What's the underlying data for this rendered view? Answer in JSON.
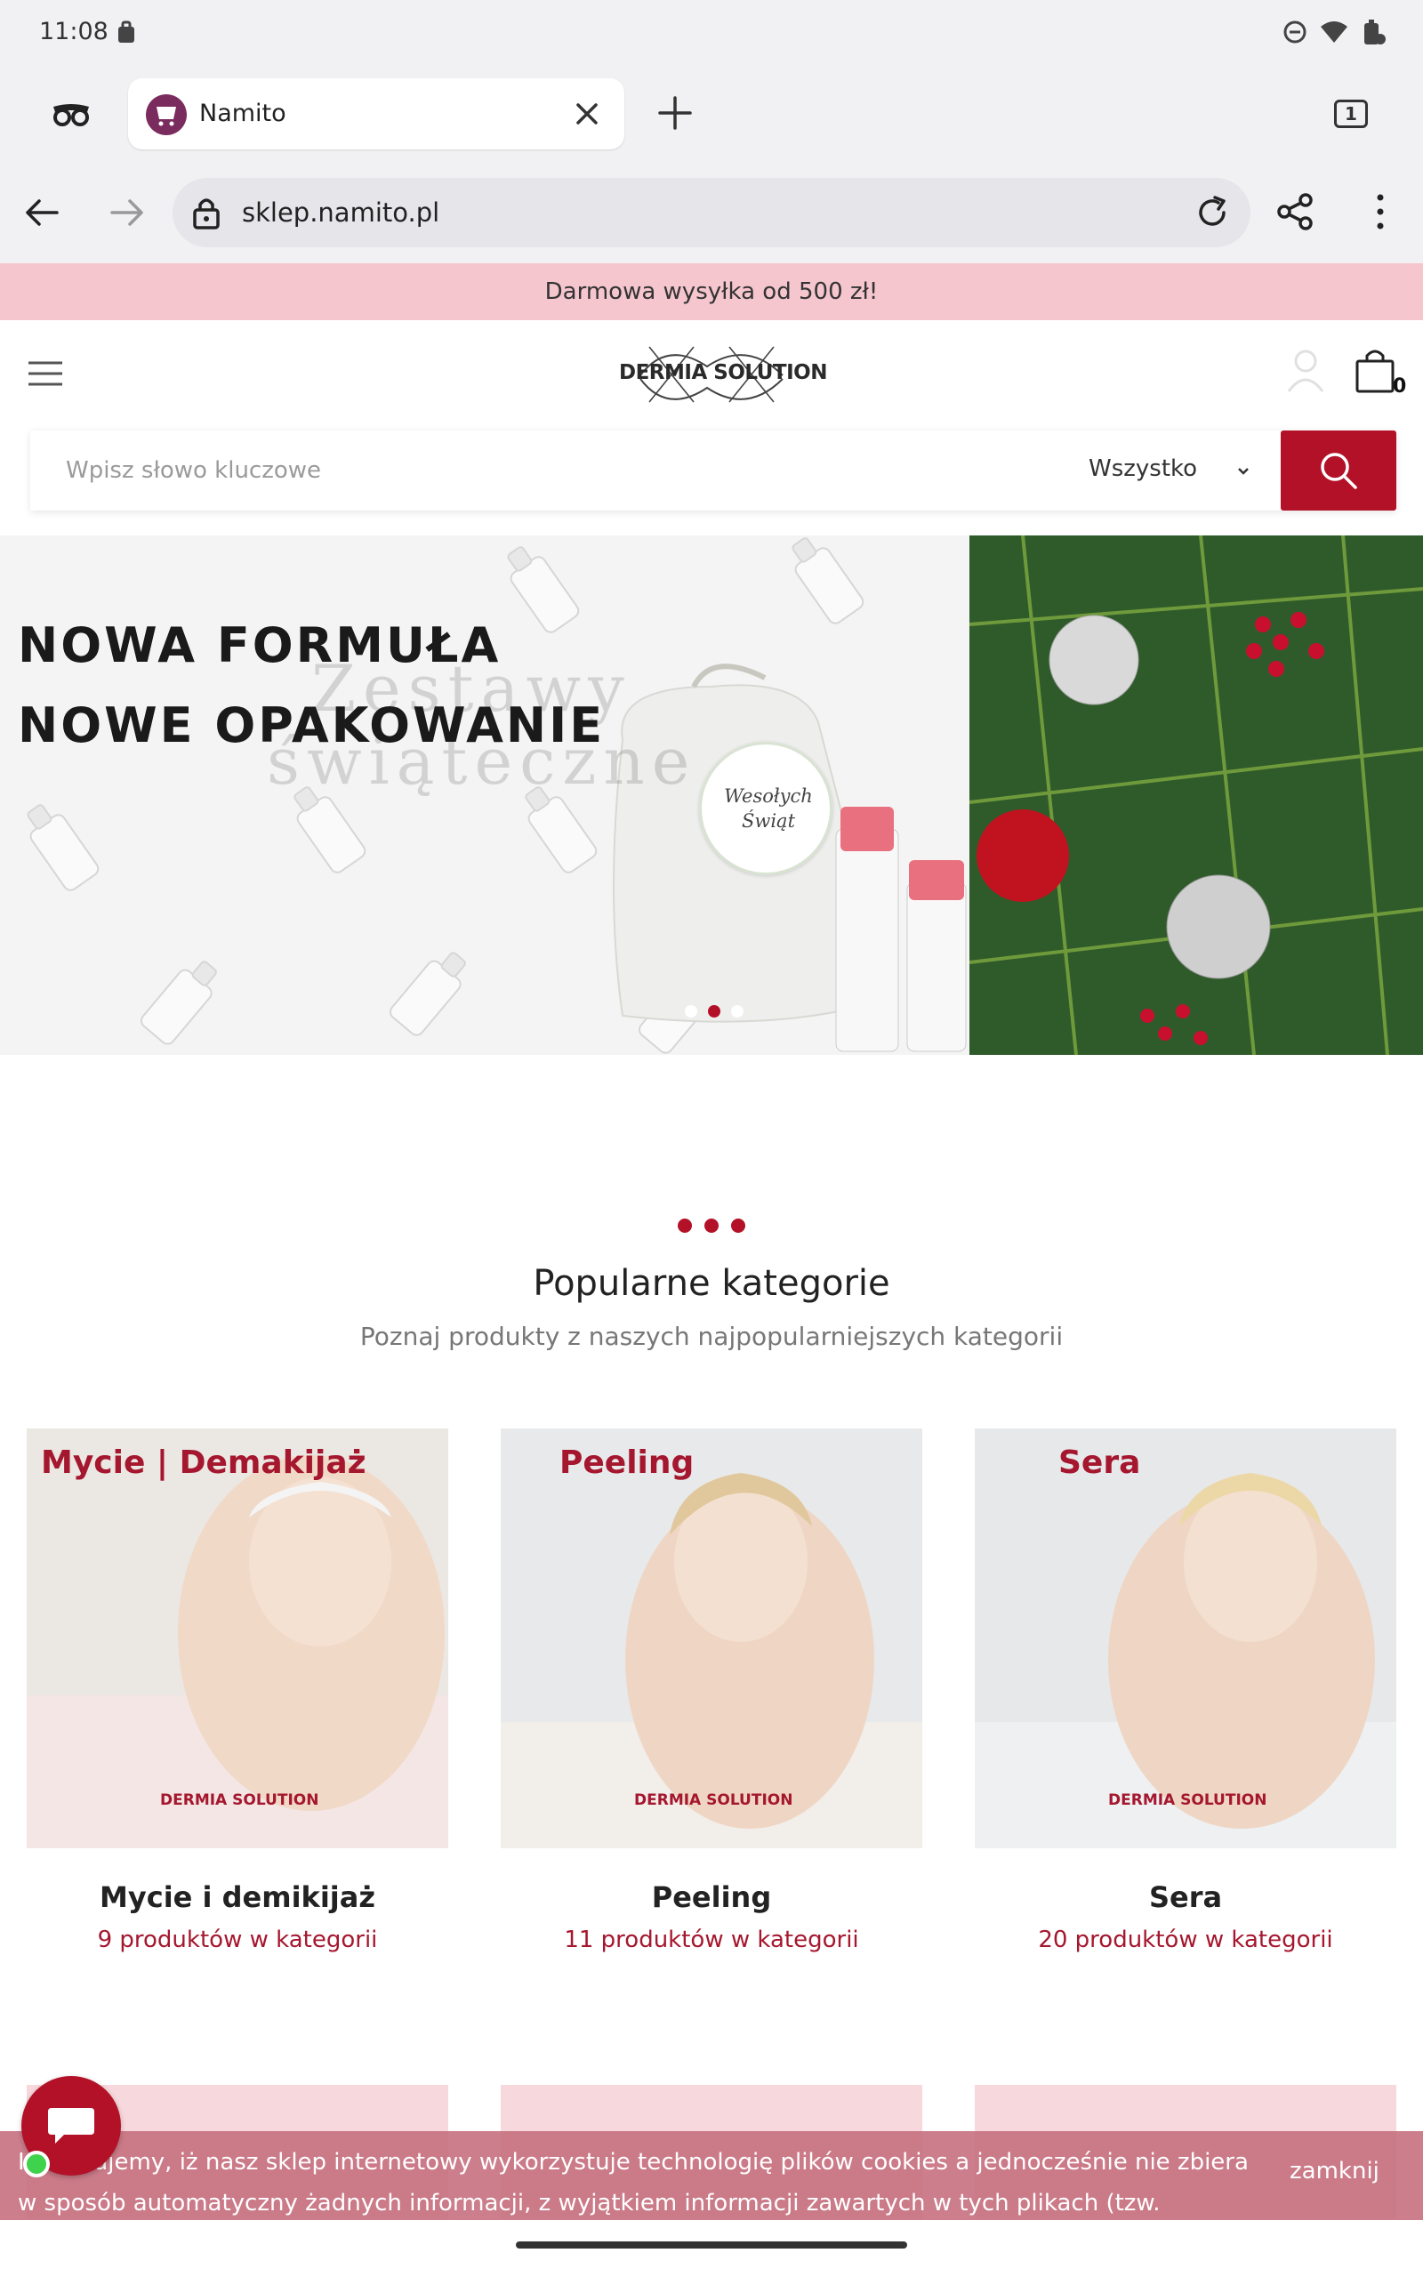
{
  "status_bar": {
    "time": "11:08"
  },
  "browser": {
    "tab": {
      "title": "Namito"
    },
    "tab_count": "1",
    "url": "sklep.namito.pl"
  },
  "site": {
    "promo": "Darmowa wysyłka od 500 zł!",
    "logo": "DERMIA SOLUTION",
    "cart_count": "0",
    "search": {
      "placeholder": "Wpisz słowo kluczowe",
      "category": "Wszystko"
    },
    "hero": {
      "line1": "NOWA FORMUŁA",
      "line2": "NOWE OPAKOWANIE",
      "ghost1": "Zestawy",
      "ghost2": "świąteczne",
      "card": "Wesołych Świąt",
      "slides": 3,
      "active_slide": 2
    },
    "popular": {
      "title": "Popularne kategorie",
      "subtitle": "Poznaj produkty z naszych najpopularniejszych kategorii"
    },
    "categories": [
      {
        "overlay": "Mycie | Demakijaż",
        "name": "Mycie i demikijaż",
        "count": "9 produktów w kategorii"
      },
      {
        "overlay": "Peeling",
        "name": "Peeling",
        "count": "11 produktów w kategorii"
      },
      {
        "overlay": "Sera",
        "name": "Sera",
        "count": "20 produktów w kategorii"
      }
    ],
    "cookie": {
      "text": "Informujemy, iż nasz sklep internetowy wykorzystuje technologię plików cookies a jednocześnie nie zbiera w sposób automatyczny żadnych informacji, z wyjątkiem informacji zawartych w tych plikach (tzw. „ciasteczkach”).",
      "close": "zamknij"
    }
  },
  "colors": {
    "accent": "#b31127",
    "promo_bg": "#f6c6cf",
    "category_text": "#a5172e"
  }
}
